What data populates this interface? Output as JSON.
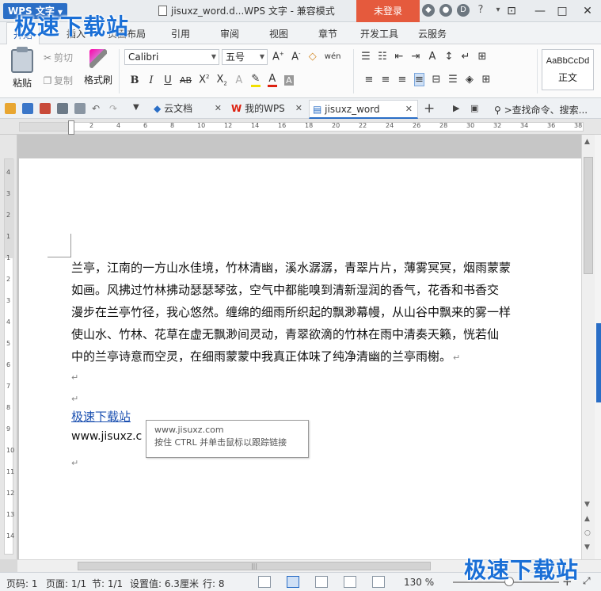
{
  "titlebar": {
    "app_menu": "WPS 文字",
    "doc_title": "jisuxz_word.d...WPS 文字 - 兼容模式",
    "login": "未登录",
    "help": "?"
  },
  "ribbon_tabs": [
    "开始",
    "插入",
    "页面布局",
    "引用",
    "审阅",
    "视图",
    "章节",
    "开发工具",
    "云服务"
  ],
  "ribbon": {
    "paste": "粘贴",
    "cut": "剪切",
    "copy": "复制",
    "format_painter": "格式刷",
    "font_name": "Calibri",
    "font_size": "五号",
    "style_sample": "AaBbCcDd",
    "style_name": "正文"
  },
  "doc_tabs": [
    {
      "label": "云文档"
    },
    {
      "label": "我的WPS"
    },
    {
      "label": "jisuxz_word"
    }
  ],
  "search_cmd": ">查找命令、搜索...",
  "ruler": {
    "h_numbers": [
      "2",
      "4",
      "6",
      "8",
      "10",
      "12",
      "14",
      "16",
      "18",
      "20",
      "22",
      "24",
      "26",
      "28",
      "30",
      "32",
      "34",
      "36",
      "38"
    ],
    "v_numbers": [
      "4",
      "3",
      "2",
      "1",
      "1",
      "2",
      "3",
      "4",
      "5",
      "6",
      "7",
      "8",
      "9",
      "10",
      "11",
      "12",
      "13",
      "14"
    ]
  },
  "document": {
    "paragraph_lines": [
      "兰亭，江南的一方山水佳境，竹林清幽，溪水潺潺，青翠片片，薄雾冥冥，烟雨蒙蒙",
      "如画。风拂过竹林拂动瑟瑟琴弦，空气中都能嗅到清新湿润的香气，花香和书香交",
      "漫步在兰亭竹径，我心悠然。缠绵的细雨所织起的飘渺幕幔，从山谷中飘来的雾一样",
      "使山水、竹林、花草在虚无飘渺间灵动，青翠欲滴的竹林在雨中清奏天籁，恍若仙",
      "中的兰亭诗意而空灵，在细雨蒙蒙中我真正体味了纯净清幽的兰亭雨榭。"
    ],
    "para_mark": "↵",
    "link_text": "极速下载站",
    "url_text": "www.jisuxz.c"
  },
  "tooltip": {
    "url": "www.jisuxz.com",
    "hint": "按住 CTRL 并单击鼠标以跟踪链接"
  },
  "status": {
    "page_no": "页码: 1",
    "pages": "页面: 1/1",
    "section": "节: 1/1",
    "setting": "设置值: 6.3厘米",
    "row": "行: 8",
    "zoom": "130 %"
  },
  "watermark": "极速下载站",
  "colors": {
    "accent": "#2a6ec6",
    "login_bg": "#e55a3d",
    "link": "#1a4fb0"
  }
}
